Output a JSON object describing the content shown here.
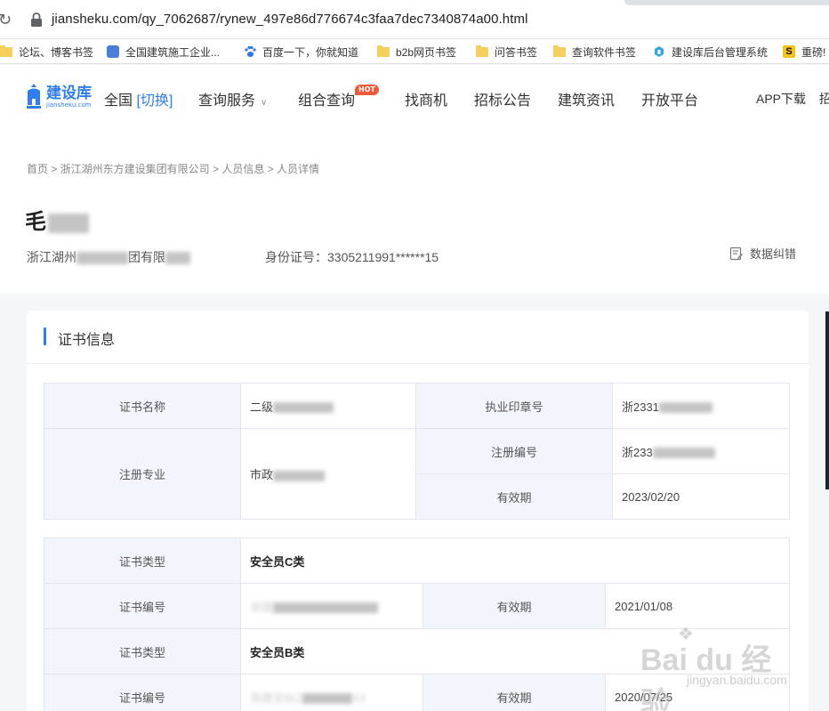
{
  "browser": {
    "reload_icon": "reload-icon",
    "url": "jiansheku.com/qy_7062687/rynew_497e86d776674c3faa7dec7340874a00.html",
    "bookmarks": [
      {
        "label": "论坛、博客书签",
        "icon": "folder-icon"
      },
      {
        "label": "全国建筑施工企业...",
        "icon": "site-icon"
      },
      {
        "label": "百度一下，你就知道",
        "icon": "baidu-paw-icon"
      },
      {
        "label": "b2b网页书签",
        "icon": "folder-icon"
      },
      {
        "label": "问答书签",
        "icon": "folder-icon"
      },
      {
        "label": "查询软件书签",
        "icon": "folder-icon"
      },
      {
        "label": "建设库后台管理系统",
        "icon": "site-icon"
      },
      {
        "label": "重磅!",
        "icon": "s-icon"
      }
    ]
  },
  "header": {
    "logo_name": "建设库",
    "logo_domain": "jiansheku.com",
    "region": "全国",
    "region_switch": "[切换]",
    "nav": [
      "查询服务",
      "组合查询",
      "找商机",
      "招标公告",
      "建筑资讯",
      "开放平台"
    ],
    "hot_badge": "HOT",
    "app_download": "APP下载",
    "right_cut": "招"
  },
  "breadcrumb": "首页 > 浙江湖州东方建设集团有限公司 > 人员信息 > 人员详情",
  "person": {
    "name_visible": "毛",
    "company_prefix": "浙江湖州",
    "company_mid": "团有限",
    "id_label": "身份证号：",
    "id_value": "3305211991******15",
    "feedback": "数据纠错"
  },
  "card": {
    "title": "证书信息",
    "cert1": {
      "name_label": "证书名称",
      "name_value": "二级",
      "seal_label": "执业印章号",
      "seal_value": "浙2331",
      "major_label": "注册专业",
      "major_value": "市政",
      "reg_label": "注册编号",
      "reg_value": "浙233",
      "valid_label": "有效期",
      "valid_value": "2023/02/20"
    },
    "cert2": [
      {
        "type_label": "证书类型",
        "type_value": "安全员C类",
        "no_label": "证书编号",
        "no_value": "浙建",
        "valid_label": "有效期",
        "valid_value": "2021/01/08"
      },
      {
        "type_label": "证书类型",
        "type_value": "安全员B类",
        "no_label": "证书编号",
        "no_value": "浙建安B(2",
        "no_tail": "43",
        "valid_label": "有效期",
        "valid_value": "2020/07/25"
      }
    ]
  },
  "watermark": {
    "brand": "Bai du 经验",
    "domain": "jingyan.baidu.com"
  }
}
